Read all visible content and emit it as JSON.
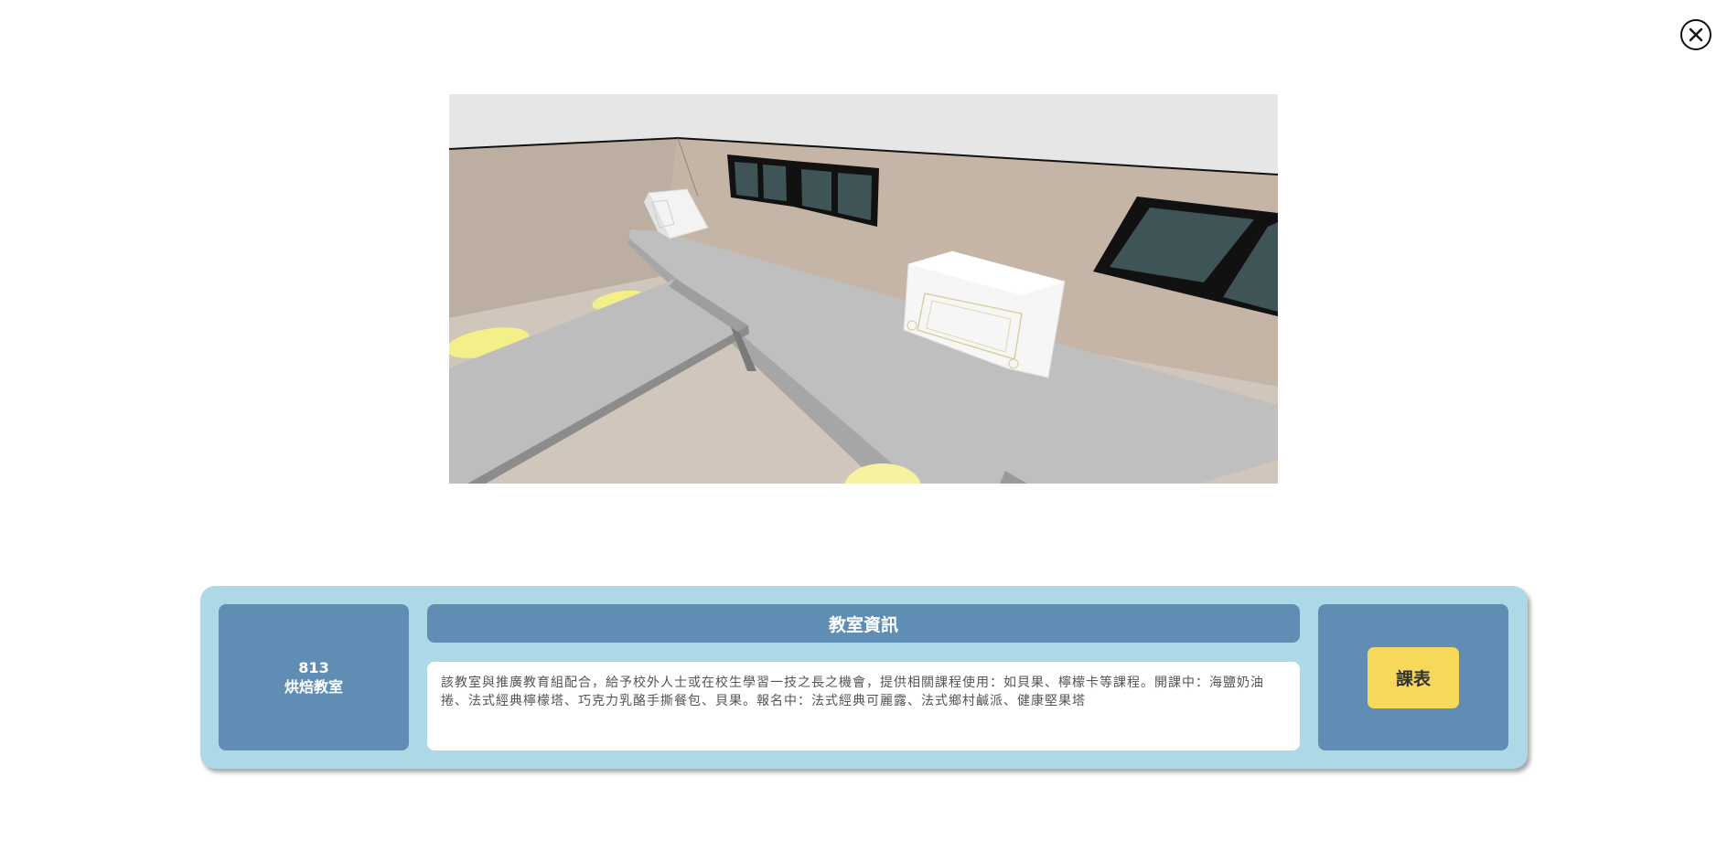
{
  "close_button": {
    "icon": "close-icon"
  },
  "room": {
    "number": "813",
    "name": "烘焙教室"
  },
  "info": {
    "title": "教室資訊",
    "description": "該教室與推廣教育組配合，給予校外人士或在校生學習一技之長之機會，提供相關課程使用：如貝果、檸檬卡等課程。開課中：海鹽奶油捲、法式經典檸檬塔、巧克力乳酪手撕餐包、貝果。報名中：法式經典可麗露、法式鄉村鹹派、健康堅果塔"
  },
  "schedule": {
    "label": "課表"
  },
  "colors": {
    "panel_bg": "#add8e6",
    "card_bg": "#5f8db4",
    "button_bg": "#f7d85a"
  }
}
